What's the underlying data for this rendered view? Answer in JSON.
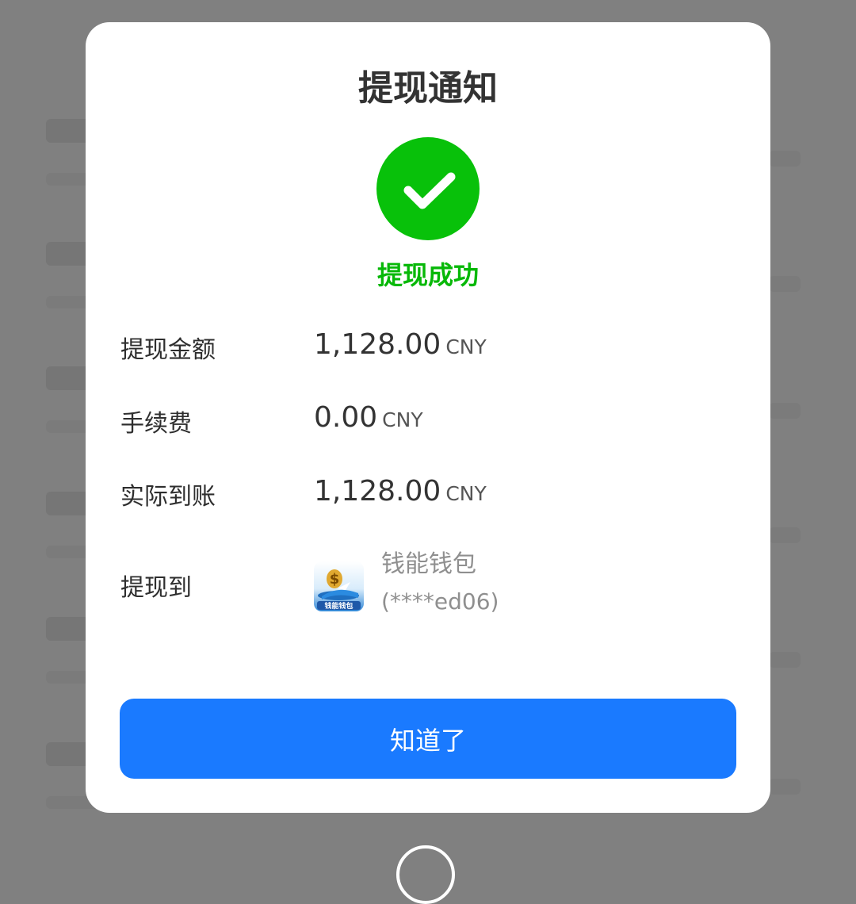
{
  "dialog": {
    "title": "提现通知",
    "status_icon": "check-circle-icon",
    "status_text": "提现成功",
    "status_color": "#08c10a",
    "rows": [
      {
        "label": "提现金额",
        "amount": "1,128.00",
        "unit": "CNY"
      },
      {
        "label": "手续费",
        "amount": "0.00",
        "unit": "CNY"
      },
      {
        "label": "实际到账",
        "amount": "1,128.00",
        "unit": "CNY"
      }
    ],
    "destination": {
      "label": "提现到",
      "wallet_icon": "wallet-app-icon",
      "wallet_name": "钱能钱包",
      "wallet_icon_text": "钱能钱包",
      "account": "(****ed06)"
    },
    "confirm_label": "知道了",
    "accent_color": "#1a7aff"
  }
}
